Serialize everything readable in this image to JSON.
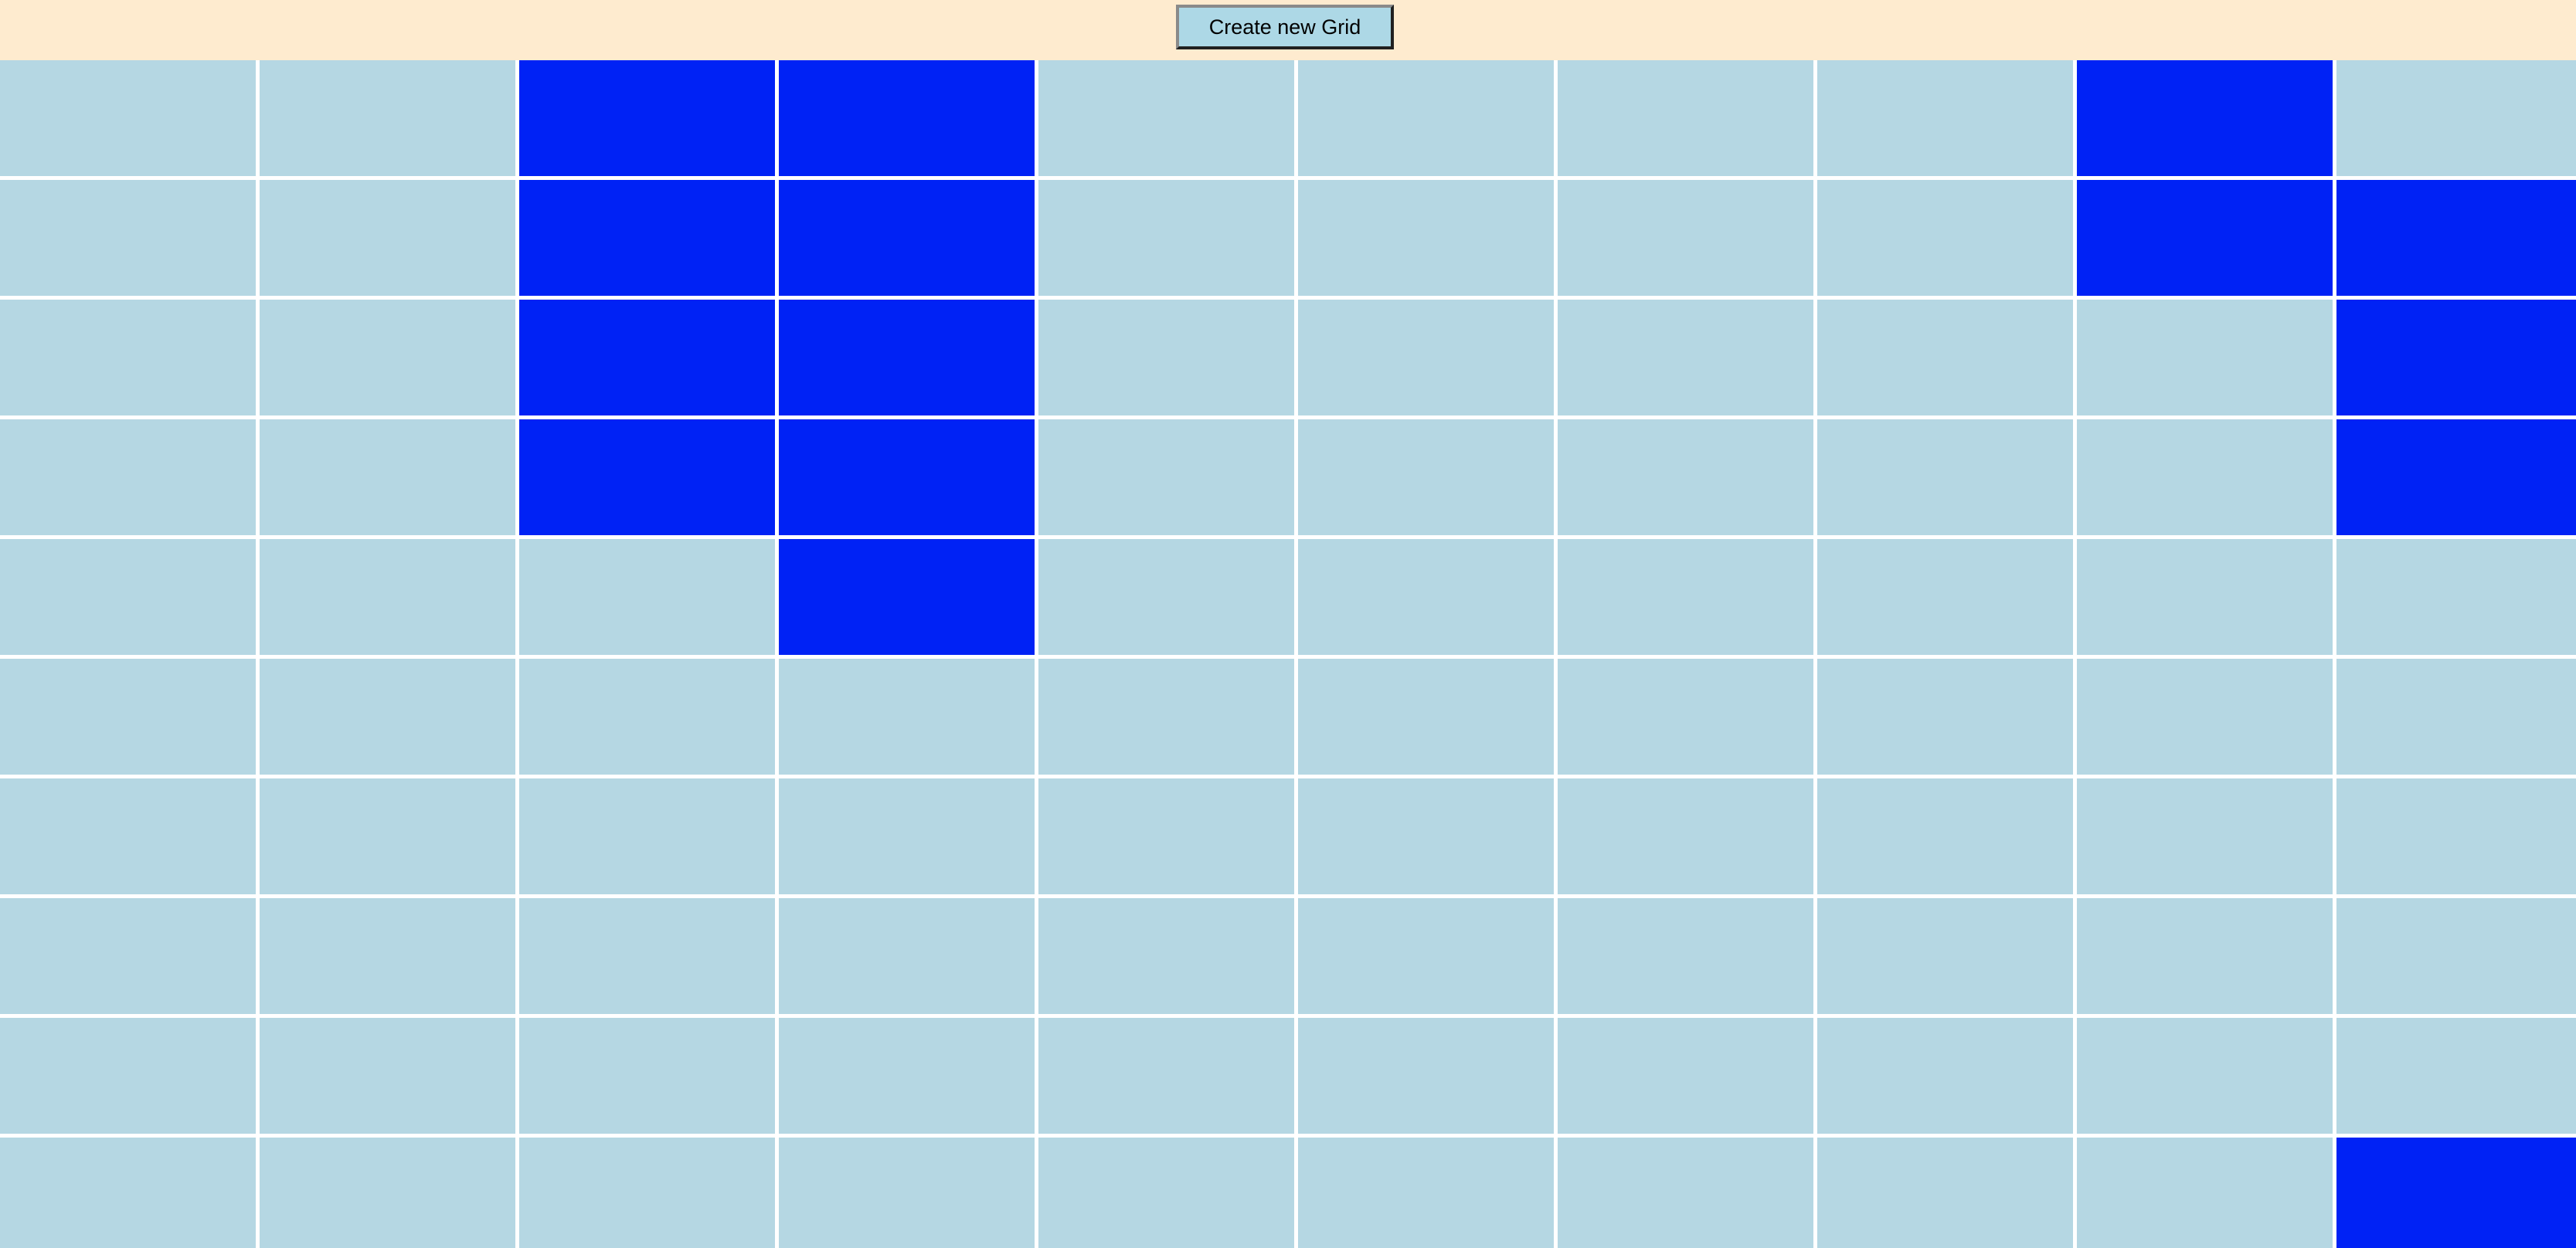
{
  "toolbar": {
    "create_label": "Create new Grid"
  },
  "colors": {
    "toolbar_background": "#feebcf",
    "button_background": "#add8e6",
    "cell_default": "#b5d7e3",
    "cell_active": "#0022f5",
    "gridline": "#ffffff"
  },
  "grid": {
    "rows": 10,
    "columns": 10,
    "states": [
      [
        0,
        0,
        1,
        1,
        0,
        0,
        0,
        0,
        1,
        0
      ],
      [
        0,
        0,
        1,
        1,
        0,
        0,
        0,
        0,
        1,
        1
      ],
      [
        0,
        0,
        1,
        1,
        0,
        0,
        0,
        0,
        0,
        1
      ],
      [
        0,
        0,
        1,
        1,
        0,
        0,
        0,
        0,
        0,
        1
      ],
      [
        0,
        0,
        0,
        1,
        0,
        0,
        0,
        0,
        0,
        0
      ],
      [
        0,
        0,
        0,
        0,
        0,
        0,
        0,
        0,
        0,
        0
      ],
      [
        0,
        0,
        0,
        0,
        0,
        0,
        0,
        0,
        0,
        0
      ],
      [
        0,
        0,
        0,
        0,
        0,
        0,
        0,
        0,
        0,
        0
      ],
      [
        0,
        0,
        0,
        0,
        0,
        0,
        0,
        0,
        0,
        0
      ],
      [
        0,
        0,
        0,
        0,
        0,
        0,
        0,
        0,
        0,
        1
      ]
    ]
  }
}
